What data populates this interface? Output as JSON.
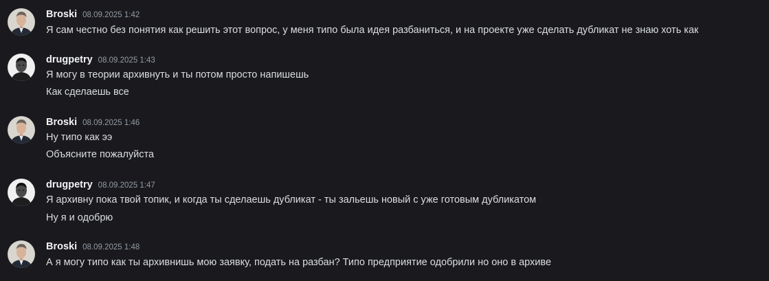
{
  "messages": [
    {
      "author": "Broski",
      "avatar": "broski-avatar",
      "timestamp": "08.09.2025 1:42",
      "lines": [
        "Я сам честно без понятия как решить этот вопрос, у меня типо была идея разбаниться, и на проекте уже сделать дубликат не знаю хоть как"
      ]
    },
    {
      "author": "drugpetry",
      "avatar": "drugpetry-avatar",
      "timestamp": "08.09.2025 1:43",
      "lines": [
        "Я могу в теории архивнуть и ты потом  просто напишешь",
        "Как сделаешь все"
      ]
    },
    {
      "author": "Broski",
      "avatar": "broski-avatar",
      "timestamp": "08.09.2025 1:46",
      "lines": [
        "Ну типо как ээ",
        "Объясните пожалуйста"
      ]
    },
    {
      "author": "drugpetry",
      "avatar": "drugpetry-avatar",
      "timestamp": "08.09.2025 1:47",
      "lines": [
        "Я архивну пока твой топик, и когда ты сделаешь дубликат - ты зальешь новый с уже готовым дубликатом",
        "Ну я и одобрю"
      ]
    },
    {
      "author": "Broski",
      "avatar": "broski-avatar",
      "timestamp": "08.09.2025 1:48",
      "lines": [
        "А я могу типо как ты архивнишь мою заявку, подать на разбан?  Типо предприятие одобрили но оно в архиве"
      ]
    }
  ],
  "colors": {
    "background": "#1a1a1e",
    "username": "#f2f3f5",
    "timestamp": "#949ba4",
    "text": "#dbdee1"
  }
}
